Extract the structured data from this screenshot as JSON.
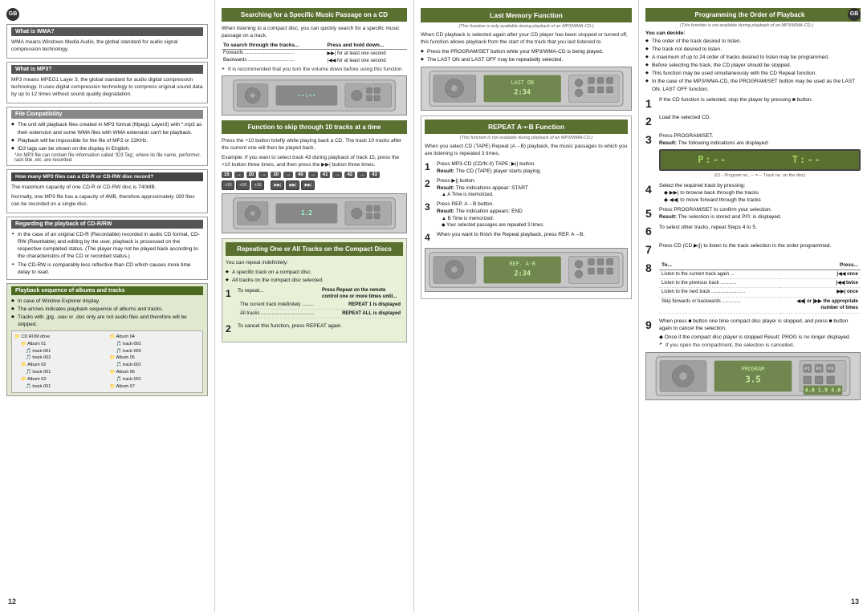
{
  "pages": {
    "left": {
      "page_number": "12",
      "gb_badge": "GB",
      "sections": {
        "what_is_wma": {
          "title": "What is WMA?",
          "body": "WMA means Windows Media Audio, the global standard for audio signal compression technology."
        },
        "what_is_mp3": {
          "title": "What is MP3?",
          "body": "MP3 means MPEG1 Layer 3, the global standard for audio digital compression technology. It uses digital compression technology to compress original sound data by up to 12 times without sound quality degradation."
        },
        "file_compatibility": {
          "title": "File Compatibility",
          "bullets": [
            "The unit will playback files created in MP3 format (Mpeg1 Layer3) with *.mp3 as their extension and some WMA files with WMA extension can't be playback.",
            "Playback will be impossible for the file of MP2 or 22KHz.",
            "ID3 tags can be shown on the display in English.",
            "*An MP3 file can contain file information called 'ID3 Tag', where its file name, performer, rack title, etc. are recorded."
          ]
        },
        "how_many": {
          "title": "How many MP3 files can a CD-R or CD-RW disc record?",
          "body": "The maximum capacity of one CD-R or CD-RW disc is 740MB.",
          "body2": "Normally, one MP3 file has a capacity of 4MB, therefore approximately 180 files can be recorded on a single disc."
        },
        "regarding": {
          "title": "Regarding the playback of CD-R/RW",
          "bullets": [
            "In the case of an original CD-R (Recordable) recorded in audio CD format, CD-RW (Rewritable) and editing by the user, playback is processed on the respective completed status. (The player may not be played back according to the characteristics of the CD or recorded status.)",
            "The CD-RW is comparably less reflective than CD which causes more time delay to read."
          ]
        },
        "playback_sequence": {
          "title": "Playback sequence of albums and tracks",
          "bullets": [
            "In case of Window Explorer display.",
            "The arrows indicates playback sequence of albums and tracks.",
            "Tracks with .jpg, .wav or .doc only are not audio files and therefore will be skipped."
          ]
        }
      }
    },
    "mid_left": {
      "sections": {
        "searching": {
          "title": "Searching for a Specific Music Passage on a CD",
          "intro": "When listening to a compact disc, you can quickly search for a specific music passage on a track.",
          "table_header1": "To search through the tracks...",
          "table_header2": "Press and hold down...",
          "rows": [
            {
              "label": "Forwards",
              "action": "▶▶| for at least one second"
            },
            {
              "label": "Backwards",
              "action": "|◀◀ for at least one second"
            }
          ],
          "note": "It is recommended that you turn the volume down before using this function."
        },
        "function_skip": {
          "title": "Function to skip through 10 tracks at a time",
          "body": "Press the +10 button briefly while playing back a CD. The track 10 tracks after the current one will then be played back.",
          "example": "Example: If you want to select track 43 during playback of track 15, press the +10 button three times, and then press the ▶▶| button three times.",
          "flow_items": [
            "15",
            "20",
            "30",
            "40",
            "41",
            "42",
            "43"
          ]
        },
        "repeating": {
          "title": "Repeating One or All Tracks on the Compact Discs",
          "body": "You can repeat indefinitely:",
          "bullets": [
            "A specific track on a compact disc.",
            "All tracks on the compact disc selected."
          ],
          "step1_label": "1",
          "step1_text": "To repeat...",
          "step1_right": "Press Repeat on the remote control one or more times until...",
          "repeat_rows": [
            {
              "label": "The current track indefinitely",
              "action": "REPEAT 1 is displayed"
            },
            {
              "label": "All tracks",
              "action": "REPEAT ALL is displayed"
            }
          ],
          "step2_label": "2",
          "step2_text": "To cancel this function, press REPEAT again."
        }
      }
    },
    "mid_right": {
      "sections": {
        "last_memory": {
          "title": "Last Memory Function",
          "sub_note": "(This function is only available during playback of an MP3/WMA-CD.)",
          "body": "When CD playback is selected again after your CD player has been stopped or turned off, this function allows playback from the start of the track that you last listened to.",
          "bullets": [
            "Press the PROGRAM/SET button while your MP3/WMA-CD is being played.",
            "The LAST ON and LAST OFF may be repeatedly selected."
          ]
        },
        "repeat_ab": {
          "title": "REPEAT A·▪·B Function",
          "sub_note": "(This function is not available during playback of an MP3/WMA-CD.)",
          "body": "When you select CD (TAPE) Repeat (A→B) playback, the music passages to which you are listening is repeated 3 times.",
          "steps": [
            {
              "num": "1",
              "text": "Press MP3-CD (CD/N·II) TAPE; ▶|| button.",
              "result": "Result: The CD (TAPE) player starts playing."
            },
            {
              "num": "2",
              "text": "Press ▶|| button.",
              "result": "Result: The indications appear: START",
              "note": "▲ A Time is memorized."
            },
            {
              "num": "3",
              "text": "Press REP. A→B button.",
              "result": "Result: The indication appears: END",
              "note": "▲ B Time is memorized.",
              "note2": "◆ Your selected passages are repeated 3 times."
            },
            {
              "num": "4",
              "text": "When you want to finish the Repeat playback, press REP. A→B."
            }
          ]
        }
      }
    },
    "right": {
      "page_number": "13",
      "gb_badge": "GB",
      "sections": {
        "programming": {
          "title": "Programming the Order of Playback",
          "sub_note": "(This function is not available during playback of an MP3/WMA-CD.)",
          "you_can_decide": "You can decide:",
          "bullets": [
            "The order of the track desired to listen.",
            "The track not desired to listen.",
            "A maximum of up to 24 order of tracks desired to listen may be programmed.",
            "Before selecting the track, the CD player should be stopped.",
            "This function may be used simultaneously with the CD Repeat function.",
            "In the case of the MP3/WMA-CD, the PROGRAM/SET button may be used as the LAST ON, LAST OFF function."
          ],
          "steps": [
            {
              "num": "1",
              "text": "If the CD function is selected, stop the player by pressing ■ button."
            },
            {
              "num": "2",
              "text": "Load the selected CD."
            },
            {
              "num": "3",
              "text": "Press PROGRAM/SET.",
              "result": "Result: The following indications are displayed:"
            },
            {
              "num": "4",
              "text": "Select the required track by pressing:",
              "sub_bullets": [
                "▶▶| to browse back through the tracks",
                "◀◀| to move forward through the tracks"
              ]
            },
            {
              "num": "5",
              "text": "Press PROGRAM/SET to confirm your selection.",
              "result": "Result: The selection is stored and P/0: is displayed."
            },
            {
              "num": "6",
              "text": "To select other tracks, repeat Steps 4 to 5."
            },
            {
              "num": "7",
              "text": "Press CD (CD ▶||) to listen to the track selection in the order programmed."
            },
            {
              "num": "8",
              "text": "To...",
              "table_rows": [
                {
                  "label": "Listen to the current track again",
                  "action": "|◀◀ once"
                },
                {
                  "label": "Listen to the previous track",
                  "action": "|◀◀ twice"
                },
                {
                  "label": "Listen to the next track",
                  "action": "▶▶| once"
                },
                {
                  "label": "Skip forwards or backwards",
                  "action": "◀◀| or |▶▶ the appropriate number of times"
                }
              ]
            },
            {
              "num": "9",
              "text": "When press ■ button one time compact disc player is stopped, and press ■ button again to cancel the selection.",
              "notes": [
                "◆ Once if the compact disc player is stopped Result: PROG is no longer displayed.",
                "➤ If you open the compartment, the selection is cancelled."
              ]
            }
          ]
        }
      }
    }
  },
  "icons": {
    "arrow_right": "→",
    "bullet": "◆",
    "arrow": "➤",
    "play": "▶",
    "stop": "■",
    "forward": "▶▶|",
    "backward": "|◀◀"
  }
}
